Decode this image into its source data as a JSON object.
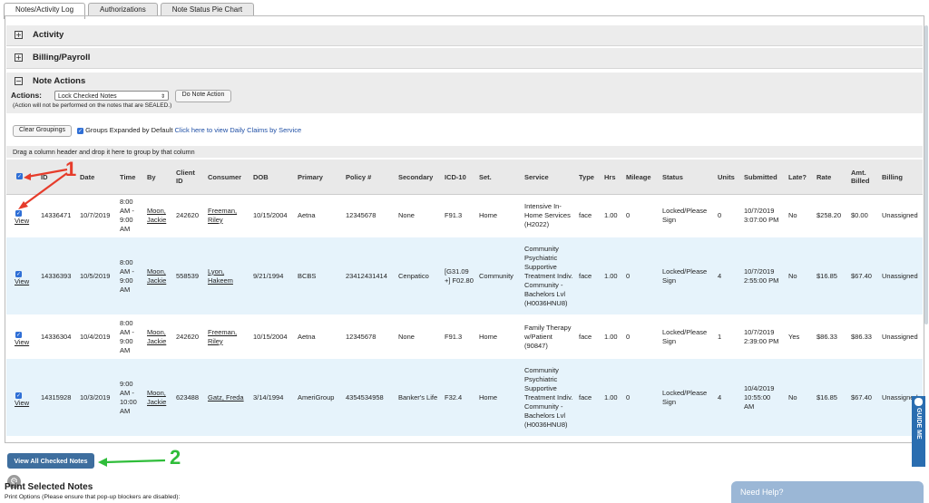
{
  "tabs": [
    "Notes/Activity Log",
    "Authorizations",
    "Note Status Pie Chart"
  ],
  "sections": {
    "activity": "Activity",
    "billing": "Billing/Payroll",
    "note_actions": "Note Actions"
  },
  "note_actions": {
    "actions_label": "Actions:",
    "selected_action": "Lock Checked Notes",
    "do_button": "Do Note Action",
    "note": "(Action will not be performed on the notes that are SEALED.)"
  },
  "grouping": {
    "clear_button": "Clear Groupings",
    "expanded_label": "Groups Expanded by Default",
    "daily_claims_link": "Click here to view Daily Claims by Service",
    "drag_hint": "Drag a column header and drop it here to group by that column"
  },
  "columns": [
    "ID",
    "Date",
    "Time",
    "By",
    "Client ID",
    "Consumer",
    "DOB",
    "Primary",
    "Policy #",
    "Secondary",
    "ICD-10",
    "Set.",
    "Service",
    "Type",
    "Hrs",
    "Mileage",
    "Status",
    "Units",
    "Submitted",
    "Late?",
    "Rate",
    "Amt. Billed",
    "Billing"
  ],
  "rows": [
    {
      "view": "View",
      "id": "14336471",
      "date": "10/7/2019",
      "time": "8:00 AM - 9:00 AM",
      "by": "Moon, Jackie",
      "client_id": "242620",
      "consumer": "Freeman, Riley",
      "dob": "10/15/2004",
      "primary": "Aetna",
      "policy": "12345678",
      "secondary": "None",
      "icd": "F91.3",
      "set": "Home",
      "service": "Intensive In-Home Services (H2022)",
      "type": "face",
      "hrs": "1.00",
      "mileage": "0",
      "status": "Locked/Please Sign",
      "units": "0",
      "submitted": "10/7/2019 3:07:00 PM",
      "late": "No",
      "rate": "$258.20",
      "amt": "$0.00",
      "billing": "Unassigned"
    },
    {
      "view": "View",
      "id": "14336393",
      "date": "10/5/2019",
      "time": "8:00 AM - 9:00 AM",
      "by": "Moon, Jackie",
      "client_id": "558539",
      "consumer": "Lyon, Hakeem",
      "dob": "9/21/1994",
      "primary": "BCBS",
      "policy": "23412431414",
      "secondary": "Cenpatico",
      "icd": "[G31.09 +] F02.80",
      "set": "Community",
      "service": "Community Psychiatric Supportive Treatment Indiv. Community - Bachelors Lvl (H0036HNU8)",
      "type": "face",
      "hrs": "1.00",
      "mileage": "0",
      "status": "Locked/Please Sign",
      "units": "4",
      "submitted": "10/7/2019 2:55:00 PM",
      "late": "No",
      "rate": "$16.85",
      "amt": "$67.40",
      "billing": "Unassigned"
    },
    {
      "view": "View",
      "id": "14336304",
      "date": "10/4/2019",
      "time": "8:00 AM - 9:00 AM",
      "by": "Moon, Jackie",
      "client_id": "242620",
      "consumer": "Freeman, Riley",
      "dob": "10/15/2004",
      "primary": "Aetna",
      "policy": "12345678",
      "secondary": "None",
      "icd": "F91.3",
      "set": "Home",
      "service": "Family Therapy w/Patient (90847)",
      "type": "face",
      "hrs": "1.00",
      "mileage": "0",
      "status": "Locked/Please Sign",
      "units": "1",
      "submitted": "10/7/2019 2:39:00 PM",
      "late": "Yes",
      "rate": "$86.33",
      "amt": "$86.33",
      "billing": "Unassigned"
    },
    {
      "view": "View",
      "id": "14315928",
      "date": "10/3/2019",
      "time": "9:00 AM - 10:00 AM",
      "by": "Moon, Jackie",
      "client_id": "623488",
      "consumer": "Gatz, Freda",
      "dob": "3/14/1994",
      "primary": "AmeriGroup",
      "policy": "4354534958",
      "secondary": "Banker's Life",
      "icd": "F32.4",
      "set": "Home",
      "service": "Community Psychiatric Supportive Treatment Indiv. Community - Bachelors Lvl (H0036HNU8)",
      "type": "face",
      "hrs": "1.00",
      "mileage": "0",
      "status": "Locked/Please Sign",
      "units": "4",
      "submitted": "10/4/2019 10:55:00 AM",
      "late": "No",
      "rate": "$16.85",
      "amt": "$67.40",
      "billing": "Unassigned"
    }
  ],
  "footer": {
    "view_checked": "View All Checked Notes",
    "print_title": "Print Selected Notes",
    "print_options": "Print Options (Please ensure that pop-up blockers are disabled):",
    "need_help": "Need Help?",
    "guide": "GUIDE ME"
  },
  "annotations": {
    "one": "1",
    "two": "2"
  },
  "icons": {
    "expand": "plus-box-icon",
    "collapse": "minus-box-icon",
    "checkbox": "checkbox-checked-icon",
    "help": "gear-icon"
  },
  "colors": {
    "accent": "#3e6e9e",
    "link": "#1f4fa5",
    "row_alt": "#e6f3fb",
    "annotation_red": "#e63c2b",
    "annotation_green": "#2fbd3a"
  }
}
